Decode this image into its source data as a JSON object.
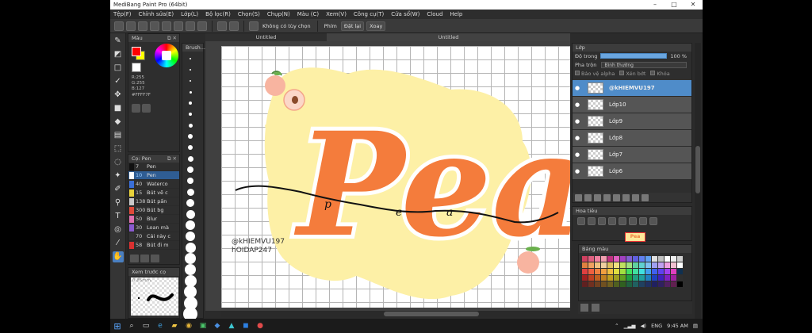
{
  "window": {
    "title": "MediBang Paint Pro (64bit)",
    "controls": [
      "–",
      "□",
      "✕"
    ]
  },
  "menu": [
    "Tệp(F)",
    "Chỉnh sửa(E)",
    "Lớp(L)",
    "Bộ lọc(R)",
    "Chọn(S)",
    "Chụp(N)",
    "Màu (C)",
    "Xem(V)",
    "Công cụ(T)",
    "Cửa sổ(W)",
    "Cloud",
    "Help"
  ],
  "toolbar": {
    "selection_label": "Không có tùy chọn",
    "snap_label": "Phím",
    "reset_label": "Đặt lại",
    "rotate_label": "Xoay"
  },
  "color_panel": {
    "title": "Màu",
    "rgb": [
      "R:255",
      "G:255",
      "B:127"
    ],
    "hex": "#FFFF7F",
    "fg": "#FF0000",
    "bg": "#FFFF00"
  },
  "brush_panel": {
    "title": "Cọ: Pen",
    "items": [
      {
        "size": "7",
        "name": "Pen",
        "color": "#111111"
      },
      {
        "size": "10",
        "name": "Pen",
        "color": "#ffffff",
        "selected": true
      },
      {
        "size": "40",
        "name": "Waterco",
        "color": "#3a6fd8"
      },
      {
        "size": "15",
        "name": "Bút vẽ c",
        "color": "#e8d23a"
      },
      {
        "size": "138",
        "name": "Bút pấn",
        "color": "#c8c8c8"
      },
      {
        "size": "300",
        "name": "Bút bg",
        "color": "#e04a3a"
      },
      {
        "size": "50",
        "name": "Blur",
        "color": "#e070b0"
      },
      {
        "size": "30",
        "name": "Loan mà",
        "color": "#8a5ad0"
      },
      {
        "size": "70",
        "name": "Cái này c",
        "color": "#333333"
      },
      {
        "size": "58",
        "name": "Bút đi m",
        "color": "#d83030"
      }
    ]
  },
  "preview_panel": {
    "title": "Xem trước cọ",
    "size": "0.85mm"
  },
  "size_panel": {
    "title": "Brush..."
  },
  "tabs": [
    "Untitled",
    "Untitled"
  ],
  "canvas": {
    "title_text": "Pea",
    "wave_letters": [
      "p",
      "e",
      "a"
    ],
    "watermark_line1": "@kHIEMVU197",
    "watermark_line2": "hOIDAP247"
  },
  "layer_panel": {
    "title": "Lớp",
    "opacity_label": "Độ trong",
    "opacity_value": "100 %",
    "blend_label": "Pha trộn",
    "blend_value": "Bình thường",
    "protect_alpha": "Bảo vệ alpha",
    "clipping": "Xén bớt",
    "lock": "Khóa",
    "layers": [
      {
        "name": "@kHIEMVU197",
        "selected": true
      },
      {
        "name": "Lớp10"
      },
      {
        "name": "Lớp9"
      },
      {
        "name": "Lớp8"
      },
      {
        "name": "Lớp7"
      },
      {
        "name": "Lớp6"
      }
    ]
  },
  "navigator": {
    "title": "Hoa tiêu",
    "thumb_text": "Pea"
  },
  "palette": {
    "title": "Bảng màu"
  },
  "taskbar": {
    "lang": "ENG",
    "time": "9:45 AM"
  }
}
